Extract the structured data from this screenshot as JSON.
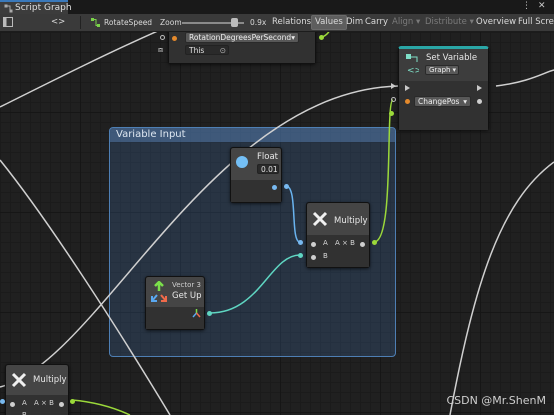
{
  "window": {
    "tab_title": "Script Graph",
    "more_label": "⋮",
    "close_label": "✕"
  },
  "toolbar": {
    "nav_label": "<>",
    "breadcrumb": "RotateSpeed",
    "zoom_label": "Zoom",
    "zoom_value": "0.9x",
    "zoom_level": 0.9,
    "buttons": [
      "Relations",
      "Values",
      "Dim",
      "Carry",
      "Align ▾",
      "Distribute ▾",
      "Overview",
      "Full Scre"
    ],
    "selected_button": "Values"
  },
  "nodes": {
    "get_variable": {
      "dropdown": "RotationDegreesPerSecond",
      "object_field": "This"
    },
    "set_variable": {
      "title": "Set Variable",
      "kind": "Graph",
      "name_dropdown": "ChangePos"
    },
    "float_node": {
      "title": "Float",
      "value": "0.01"
    },
    "multiply_main": {
      "title": "Multiply",
      "port_a": "A",
      "port_b": "B",
      "output": "A × B"
    },
    "vector3_node": {
      "subtitle": "Vector 3",
      "title": "Get Up"
    },
    "multiply_bottom": {
      "title": "Multiply",
      "port_a": "A",
      "output": "A × B",
      "port_b": "B"
    }
  },
  "group": {
    "title": "Variable Input"
  },
  "watermark": "CSDN @Mr.ShenM",
  "colors": {
    "group_fill": "#41628c",
    "float_wire": "#69b3ef",
    "vector_wire": "#5fd6c2",
    "multiply_wire": "#9bd93a",
    "flow_wire": "#d0d0d0"
  }
}
